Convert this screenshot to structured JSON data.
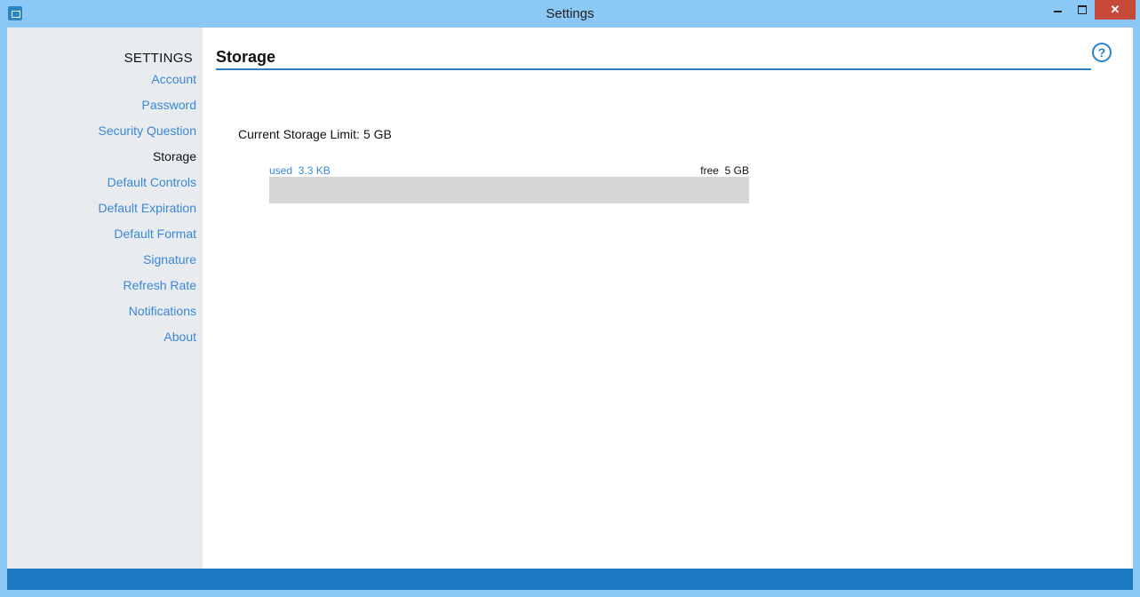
{
  "window": {
    "title": "Settings",
    "close_glyph": "✕",
    "accent": "#1c78c0"
  },
  "sidebar": {
    "heading": "SETTINGS",
    "items": [
      {
        "label": "Account"
      },
      {
        "label": "Password"
      },
      {
        "label": "Security Question"
      },
      {
        "label": "Storage",
        "active": true
      },
      {
        "label": "Default Controls"
      },
      {
        "label": "Default Expiration"
      },
      {
        "label": "Default Format"
      },
      {
        "label": "Signature"
      },
      {
        "label": "Refresh Rate"
      },
      {
        "label": "Notifications"
      },
      {
        "label": "About"
      }
    ]
  },
  "main": {
    "title": "Storage",
    "help_glyph": "?",
    "limit_label": "Current Storage Limit:",
    "limit_value": "5 GB",
    "used_label": "used  3.3 KB",
    "free_label": "free  5 GB",
    "used_fraction": 6e-07
  }
}
